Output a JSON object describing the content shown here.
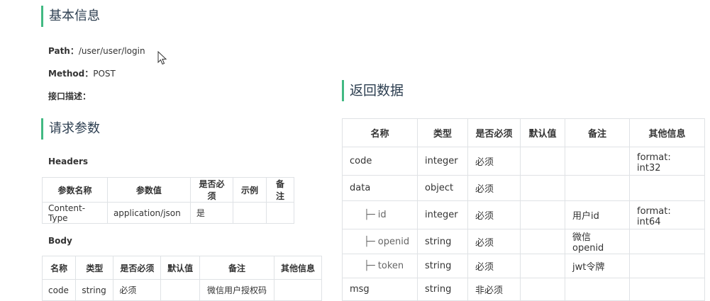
{
  "basic": {
    "title": "基本信息",
    "path_label": "Path：",
    "path_value": "/user/user/login",
    "method_label": "Method：",
    "method_value": "POST",
    "desc_label": "接口描述："
  },
  "request": {
    "title": "请求参数",
    "headers_label": "Headers",
    "headers_columns": [
      "参数名称",
      "参数值",
      "是否必须",
      "示例",
      "备注"
    ],
    "headers_row": [
      "Content-Type",
      "application/json",
      "是",
      "",
      ""
    ],
    "body_label": "Body",
    "body_columns": [
      "名称",
      "类型",
      "是否必须",
      "默认值",
      "备注",
      "其他信息"
    ],
    "body_row": [
      "code",
      "string",
      "必须",
      "",
      "微信用户授权码",
      ""
    ]
  },
  "response": {
    "title": "返回数据",
    "columns": [
      "名称",
      "类型",
      "是否必须",
      "默认值",
      "备注",
      "其他信息"
    ],
    "rows": [
      {
        "name": "code",
        "type": "integer",
        "required": "必须",
        "default": "",
        "remark": "",
        "other": "format: int32"
      },
      {
        "name": "data",
        "type": "object",
        "required": "必须",
        "default": "",
        "remark": "",
        "other": ""
      },
      {
        "name": "├─ id",
        "type": "integer",
        "required": "必须",
        "default": "",
        "remark": "用户id",
        "other": "format: int64"
      },
      {
        "name": "├─ openid",
        "type": "string",
        "required": "必须",
        "default": "",
        "remark": "微信openid",
        "other": ""
      },
      {
        "name": "├─ token",
        "type": "string",
        "required": "必须",
        "default": "",
        "remark": "jwt令牌",
        "other": ""
      },
      {
        "name": "msg",
        "type": "string",
        "required": "非必须",
        "default": "",
        "remark": "",
        "other": ""
      }
    ]
  },
  "colors": {
    "accent": "#42b983",
    "border": "#dfe2e5"
  },
  "icons": {
    "cursor": "mouse-pointer-icon"
  }
}
